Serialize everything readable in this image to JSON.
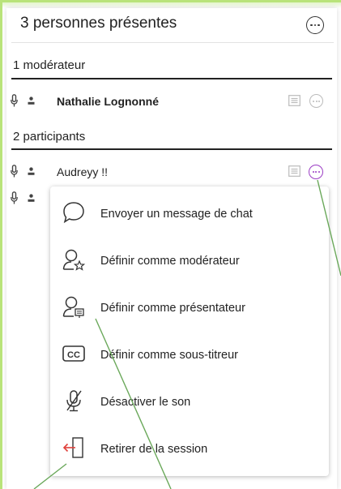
{
  "panel": {
    "title": "3 personnes présentes",
    "more_icon": "more-options-icon"
  },
  "moderators": {
    "title": "1 modérateur",
    "items": [
      {
        "name": "Nathalie Lognonné"
      }
    ]
  },
  "participants": {
    "title": "2 participants",
    "items": [
      {
        "name": "Audreyy !!"
      }
    ]
  },
  "menu": {
    "items": [
      {
        "label": "Envoyer un message de chat",
        "icon": "chat-bubble-icon"
      },
      {
        "label": "Définir comme modérateur",
        "icon": "moderator-icon"
      },
      {
        "label": "Définir comme présentateur",
        "icon": "presenter-icon"
      },
      {
        "label": "Définir comme sous-titreur",
        "icon": "captioner-cc-icon"
      },
      {
        "label": "Désactiver le son",
        "icon": "mute-microphone-icon"
      },
      {
        "label": "Retirer de la session",
        "icon": "remove-from-session-icon"
      }
    ]
  },
  "colors": {
    "accent_purple": "#9b3cc4",
    "annotation_green": "#6aa85a",
    "remove_red": "#e0403a",
    "frame_green": "#b9e37a"
  }
}
